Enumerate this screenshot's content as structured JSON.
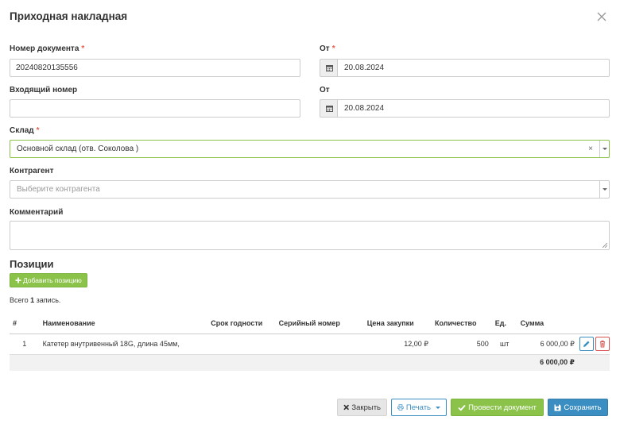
{
  "modal": {
    "title": "Приходная накладная"
  },
  "form": {
    "doc_number": {
      "label": "Номер документа",
      "required_mark": "*",
      "value": "20240820135556"
    },
    "doc_date": {
      "label": "От",
      "required_mark": "*",
      "value": "20.08.2024"
    },
    "incoming_number": {
      "label": "Входящий номер",
      "value": ""
    },
    "incoming_date": {
      "label": "От",
      "value": "20.08.2024"
    },
    "warehouse": {
      "label": "Склад",
      "required_mark": "*",
      "value": "Основной склад (отв. Соколова )",
      "clear": "×"
    },
    "counterparty": {
      "label": "Контрагент",
      "placeholder": "Выберите контрагента"
    },
    "comment": {
      "label": "Комментарий",
      "value": ""
    }
  },
  "positions": {
    "title": "Позиции",
    "add_button": "Добавить позицию",
    "count_prefix": "Всего",
    "count": "1",
    "count_suffix": "запись.",
    "columns": [
      "#",
      "Наименование",
      "Срок годности",
      "Серийный номер",
      "Цена закупки",
      "Количество",
      "Ед.",
      "Сумма"
    ],
    "rows": [
      {
        "num": "1",
        "name": "Катетер внутривенный 18G, длина 45мм,",
        "expiry": "",
        "serial": "",
        "price": "12,00 ₽",
        "qty": "500",
        "unit": "шт",
        "sum": "6 000,00 ₽"
      }
    ],
    "total": "6 000,00 ₽"
  },
  "footer": {
    "close": "Закрыть",
    "print": "Печать",
    "post": "Провести документ",
    "save": "Сохранить"
  },
  "colors": {
    "accent_green": "#8ac24a",
    "accent_blue": "#3b8ec2",
    "danger_red": "#d9534f",
    "required_mark": "#e8604c"
  }
}
